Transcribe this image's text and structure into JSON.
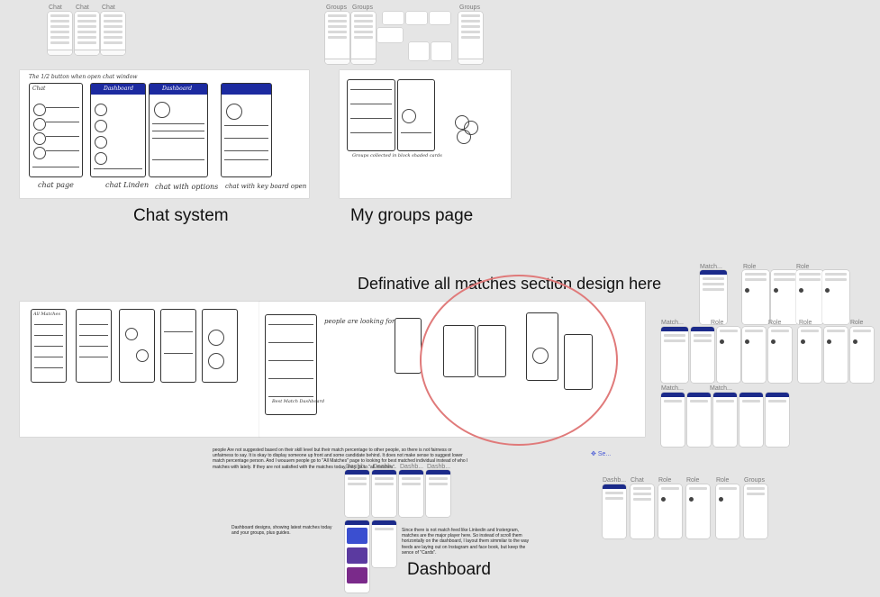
{
  "frame_labels": {
    "chat_top": [
      "Chat",
      "Chat",
      "Chat"
    ],
    "groups_top": [
      "Groups",
      "Groups",
      "Groups"
    ],
    "matches_right": [
      "Match...",
      "Role",
      "Role"
    ],
    "matches_mid": [
      "Match...",
      "Role",
      "Role",
      "Role",
      "Role"
    ],
    "matches_low": [
      "Match...",
      "Match..."
    ],
    "bottom_right": [
      "Dashb...",
      "Chat",
      "Role",
      "Role",
      "Role",
      "Groups"
    ],
    "dash_top": [
      "Dashb...",
      "Dashb...",
      "Dashb...",
      "Dashb..."
    ],
    "selection": "Se..."
  },
  "sketch_captions": {
    "chat": [
      "The 1/2 button when open chat window",
      "chat page",
      "chat Linden",
      "chat with options",
      "chat with key board open"
    ],
    "chat_header": [
      "Chat",
      "Dashboard",
      "Dashboard"
    ],
    "groups": [
      "Groups collected in block shaded cards"
    ],
    "matches": [
      "All Matches",
      "people are looking for",
      "Best Match Dashboard"
    ]
  },
  "section_titles": {
    "chat": "Chat system",
    "groups": "My groups page",
    "matches": "Definative all matches section design here",
    "dashboard": "Dashboard"
  },
  "notes": {
    "matches_paragraph": "people Are not suggested based on their skill level but their match percentage to other people, so there is not fairness or unfairness to say. It is okay to display someone up front and some candidate behind. It does not make sense to suggest lower match percentage person. And I wouuem people go to \"All Matches\" page to looking for best matched individual instead of who I matches with lately. If they are not satisfied with the matches today, they go to \"all matches\".",
    "dashboard_left": "Dashboard designs, showing latest matches today and your groups, plus guides.",
    "dashboard_right": "Since there is not match feed like Linkedin and Instergram, matches are the major player here. So instead of scroll them horizontally on the dashboard, I layout them simmilar to the way feeds are laying out on Instagram and face book, but keep the sence of \"Cards\"."
  },
  "colors": {
    "canvas": "#e5e5e5",
    "accent_blue": "#1b2a8a",
    "circle_highlight": "#e07a7a"
  }
}
